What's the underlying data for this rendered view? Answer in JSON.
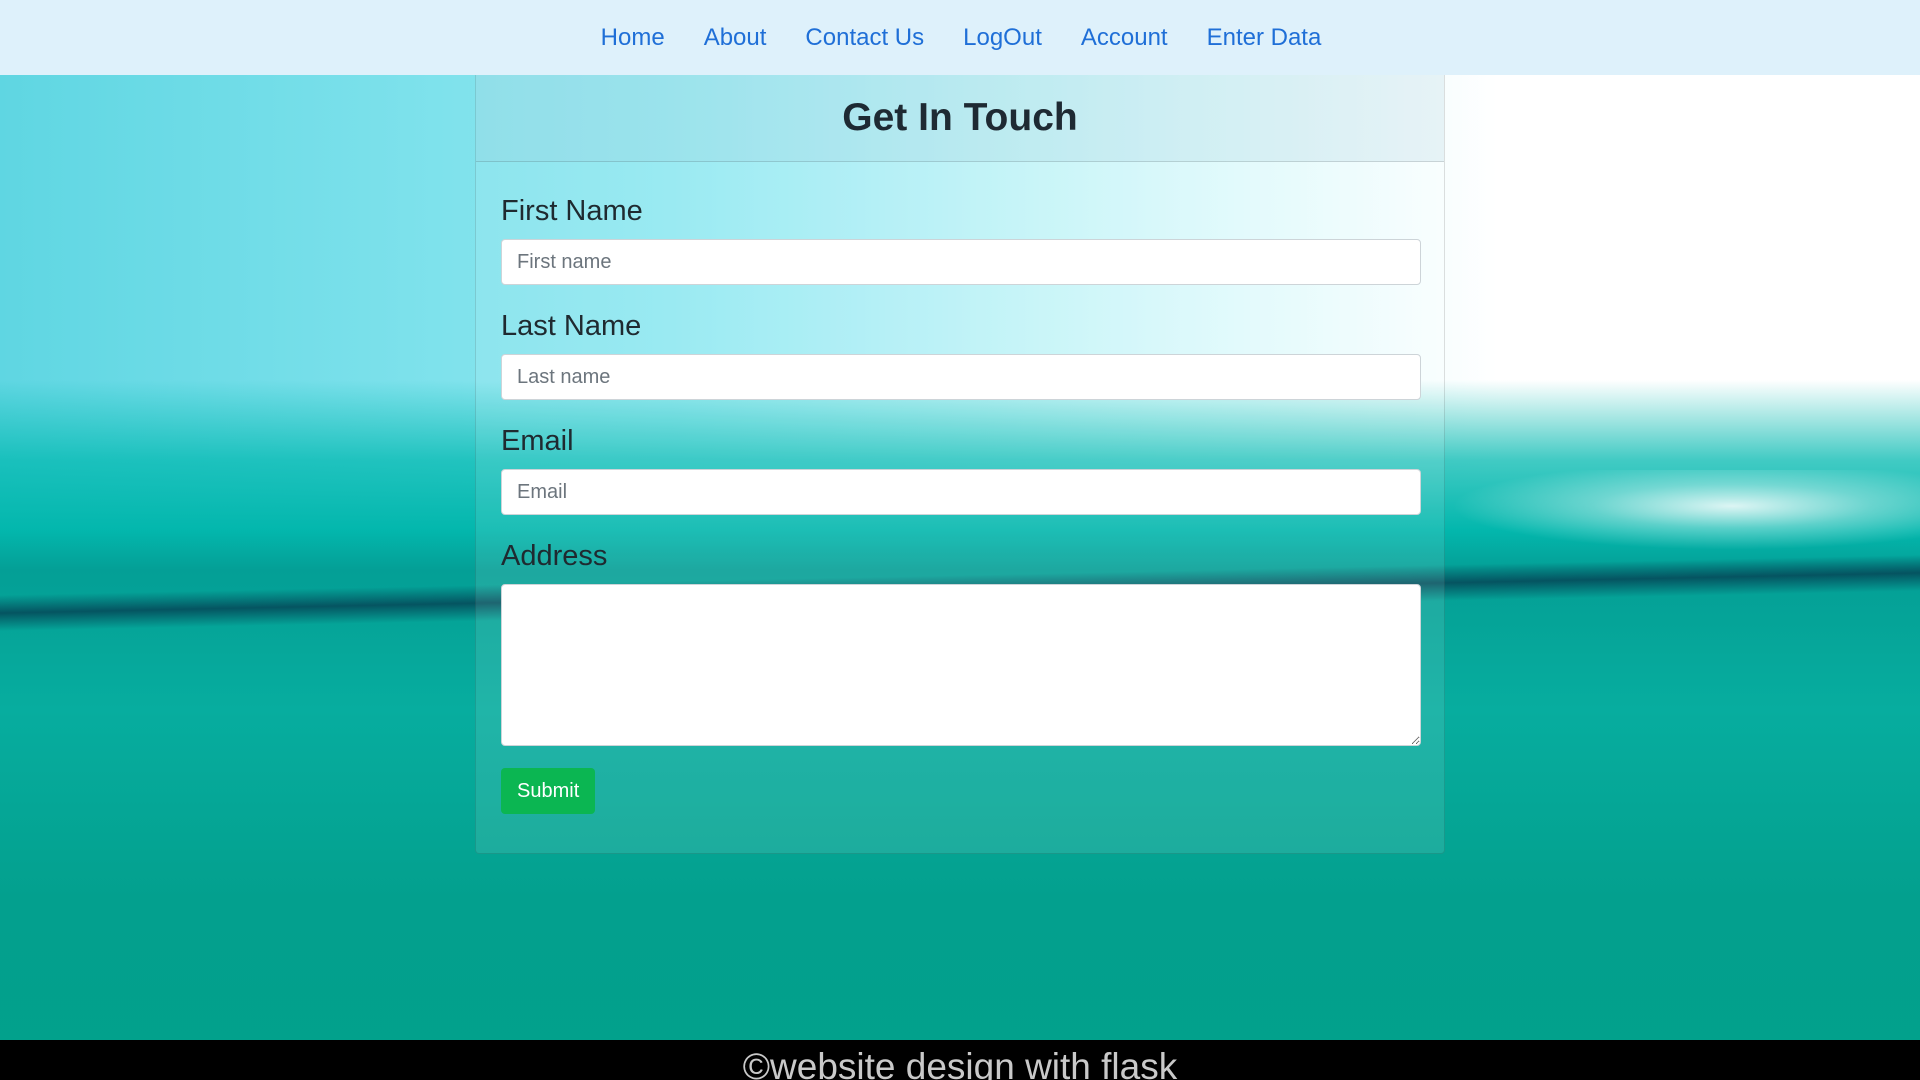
{
  "nav": {
    "items": [
      {
        "label": "Home"
      },
      {
        "label": "About"
      },
      {
        "label": "Contact Us"
      },
      {
        "label": "LogOut"
      },
      {
        "label": "Account"
      },
      {
        "label": "Enter Data"
      }
    ]
  },
  "form": {
    "title": "Get In Touch",
    "first_name": {
      "label": "First Name",
      "placeholder": "First name",
      "value": ""
    },
    "last_name": {
      "label": "Last Name",
      "placeholder": "Last name",
      "value": ""
    },
    "email": {
      "label": "Email",
      "placeholder": "Email",
      "value": ""
    },
    "address": {
      "label": "Address",
      "value": ""
    },
    "submit_label": "Submit"
  },
  "footer": {
    "text": "©website design with flask"
  },
  "colors": {
    "nav_bg": "#def1fb",
    "nav_link": "#1f6fd7",
    "submit_bg": "#0bb652",
    "footer_bg": "#000000"
  }
}
